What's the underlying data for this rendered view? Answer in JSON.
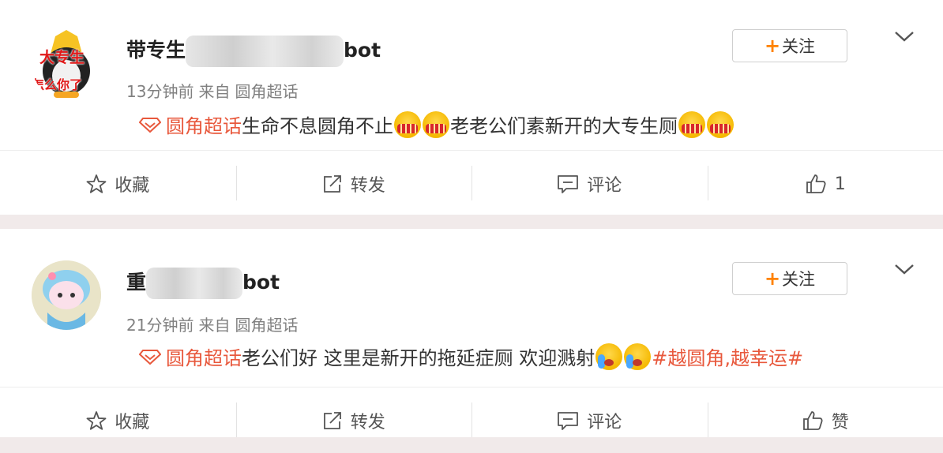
{
  "posts": [
    {
      "name_prefix": "带专生",
      "name_suffix": "bot",
      "avatar_text_top": "大专生",
      "avatar_text_bottom": "怎么你了",
      "time": "13分钟前",
      "source_label": "来自",
      "source": "圆角超话",
      "follow_label": "关注",
      "topic": "圆角超话",
      "text_a": "生命不息圆角不止",
      "text_b": "老老公们素新开的大专生厕",
      "actions": {
        "collect": "收藏",
        "repost": "转发",
        "comment": "评论",
        "like": "1"
      }
    },
    {
      "name_prefix": "重",
      "name_suffix": "bot",
      "time": "21分钟前",
      "source_label": "来自",
      "source": "圆角超话",
      "follow_label": "关注",
      "topic": "圆角超话",
      "text_a": "老公们好 这里是新开的拖延症厕 欢迎溅射",
      "hashtag": "#越圆角,越幸运#",
      "actions": {
        "collect": "收藏",
        "repost": "转发",
        "comment": "评论",
        "like": "赞"
      }
    }
  ],
  "colors": {
    "accent": "#ff8200",
    "topic": "#e8583c",
    "background": "#f1eaea"
  }
}
